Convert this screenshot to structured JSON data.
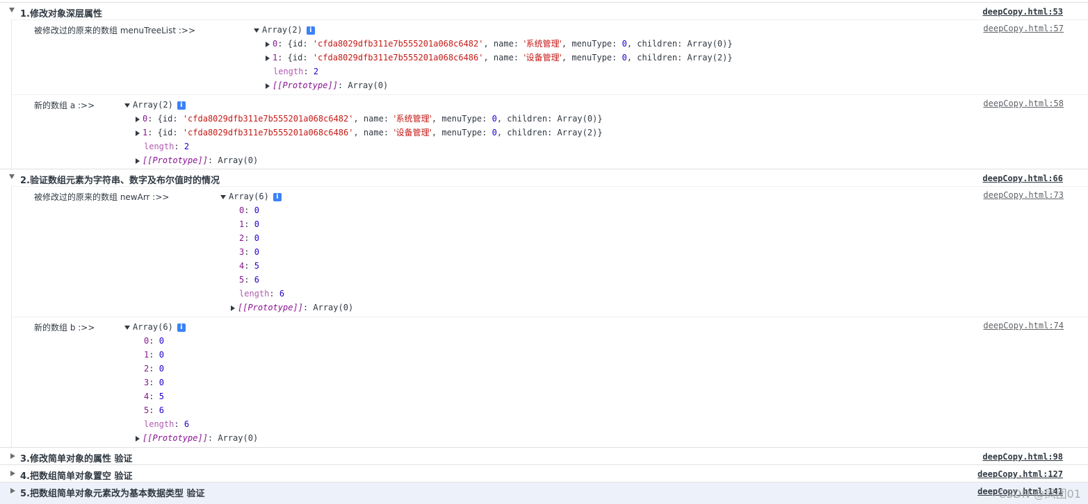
{
  "groups": [
    {
      "title": "1.修改对象深层属性",
      "source": "deepCopy.html:53",
      "expanded": true
    },
    {
      "title": "2.验证数组元素为字符串、数字及布尔值时的情况",
      "source": "deepCopy.html:66",
      "expanded": true
    },
    {
      "title": "3.修改简单对象的属性 验证",
      "source": "deepCopy.html:98",
      "expanded": false
    },
    {
      "title": "4.把数组简单对象置空 验证",
      "source": "deepCopy.html:127",
      "expanded": false
    },
    {
      "title": "5.把数组简单对象元素改为基本数据类型 验证",
      "source": "deepCopy.html:141",
      "expanded": false
    }
  ],
  "entries": [
    {
      "label": "被修改过的原来的数组 menuTreeList :>>",
      "source": "deepCopy.html:57",
      "array_label": "Array(2)",
      "items": [
        {
          "key": "0",
          "id": "'cfda8029dfb311e7b555201a068c6482'",
          "name": "'系统管理'",
          "menuType": "0",
          "children": "Array(0)"
        },
        {
          "key": "1",
          "id": "'cfda8029dfb311e7b555201a068c6486'",
          "name": "'设备管理'",
          "menuType": "0",
          "children": "Array(2)"
        }
      ],
      "length": "2",
      "prototype": "Array(0)"
    },
    {
      "label": "新的数组 a :>>",
      "source": "deepCopy.html:58",
      "array_label": "Array(2)",
      "items": [
        {
          "key": "0",
          "id": "'cfda8029dfb311e7b555201a068c6482'",
          "name": "'系统管理'",
          "menuType": "0",
          "children": "Array(0)"
        },
        {
          "key": "1",
          "id": "'cfda8029dfb311e7b555201a068c6486'",
          "name": "'设备管理'",
          "menuType": "0",
          "children": "Array(2)"
        }
      ],
      "length": "2",
      "prototype": "Array(0)"
    },
    {
      "label": "被修改过的原来的数组 newArr :>>",
      "source": "deepCopy.html:73",
      "array_label": "Array(6)",
      "values": [
        [
          "0",
          "0"
        ],
        [
          "1",
          "0"
        ],
        [
          "2",
          "0"
        ],
        [
          "3",
          "0"
        ],
        [
          "4",
          "5"
        ],
        [
          "5",
          "6"
        ]
      ],
      "length": "6",
      "prototype": "Array(0)"
    },
    {
      "label": "新的数组 b :>>",
      "source": "deepCopy.html:74",
      "array_label": "Array(6)",
      "values": [
        [
          "0",
          "0"
        ],
        [
          "1",
          "0"
        ],
        [
          "2",
          "0"
        ],
        [
          "3",
          "0"
        ],
        [
          "4",
          "5"
        ],
        [
          "5",
          "6"
        ]
      ],
      "length": "6",
      "prototype": "Array(0)"
    }
  ],
  "labels": {
    "id": "id",
    "name": "name",
    "menuType": "menuType",
    "children": "children",
    "length": "length",
    "prototype": "[[Prototype]]",
    "info": "i"
  },
  "watermark": "CSDN @凤团01"
}
